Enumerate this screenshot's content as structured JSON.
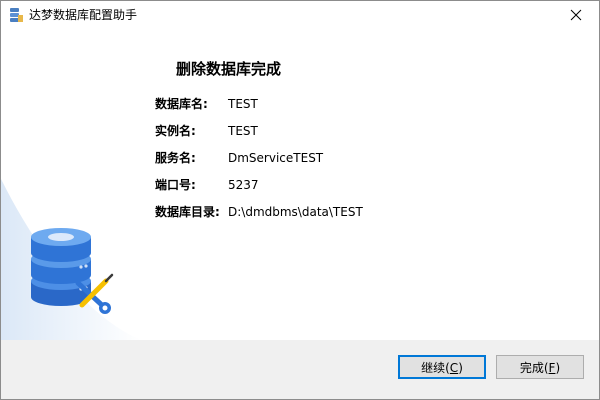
{
  "window": {
    "title": "达梦数据库配置助手"
  },
  "heading": "删除数据库完成",
  "info": [
    {
      "label": "数据库名:",
      "value": "TEST"
    },
    {
      "label": "实例名:",
      "value": "TEST"
    },
    {
      "label": "服务名:",
      "value": "DmServiceTEST"
    },
    {
      "label": "端口号:",
      "value": "5237"
    },
    {
      "label": "数据库目录:",
      "value": "D:\\dmdbms\\data\\TEST"
    }
  ],
  "buttons": {
    "continue": {
      "label": "继续(",
      "hotkey": "C",
      "suffix": ")"
    },
    "finish": {
      "label": "完成(",
      "hotkey": "F",
      "suffix": ")"
    }
  },
  "icons": {
    "app": "database-app-icon",
    "close": "close-icon",
    "illustration": "database-wrench-icon"
  },
  "colors": {
    "accent": "#0078d7",
    "database_blue": "#2f74d6",
    "wrench_yellow": "#f6c000"
  }
}
